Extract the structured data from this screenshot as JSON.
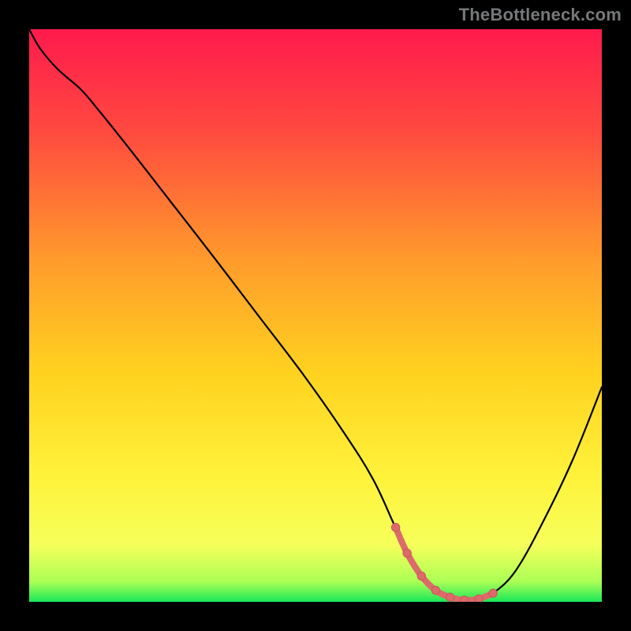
{
  "watermark": "TheBottleneck.com",
  "colors": {
    "frame": "#000000",
    "watermark": "#76787a",
    "curve": "#000000",
    "marker_fill": "#dd6a6a",
    "marker_stroke": "#c95656",
    "gradient_stops": [
      {
        "offset": 0.0,
        "color": "#ff1a4d"
      },
      {
        "offset": 0.18,
        "color": "#ff4a3f"
      },
      {
        "offset": 0.4,
        "color": "#ff9a2c"
      },
      {
        "offset": 0.6,
        "color": "#ffd21f"
      },
      {
        "offset": 0.78,
        "color": "#fff23a"
      },
      {
        "offset": 0.9,
        "color": "#f6ff5a"
      },
      {
        "offset": 0.965,
        "color": "#aaff55"
      },
      {
        "offset": 1.0,
        "color": "#18e858"
      }
    ]
  },
  "chart_data": {
    "type": "line",
    "title": "",
    "xlabel": "",
    "ylabel": "",
    "x": [
      0.0,
      0.02,
      0.05,
      0.09,
      0.12,
      0.18,
      0.25,
      0.32,
      0.4,
      0.48,
      0.55,
      0.6,
      0.635,
      0.66,
      0.685,
      0.71,
      0.735,
      0.76,
      0.785,
      0.81,
      0.85,
      0.9,
      0.95,
      1.0
    ],
    "y": [
      1.0,
      0.965,
      0.93,
      0.895,
      0.86,
      0.785,
      0.695,
      0.605,
      0.5,
      0.395,
      0.295,
      0.215,
      0.14,
      0.085,
      0.045,
      0.02,
      0.008,
      0.003,
      0.005,
      0.015,
      0.055,
      0.145,
      0.25,
      0.375
    ],
    "xlim": [
      0,
      1
    ],
    "ylim": [
      0,
      1
    ],
    "trough_markers_x": [
      0.64,
      0.66,
      0.685,
      0.71,
      0.735,
      0.76,
      0.785,
      0.81
    ],
    "trough_markers_y": [
      0.13,
      0.085,
      0.045,
      0.02,
      0.008,
      0.003,
      0.005,
      0.015
    ],
    "note": "x,y normalized to [0,1]; y=1 at top, y=0 at bottom of plot area"
  }
}
